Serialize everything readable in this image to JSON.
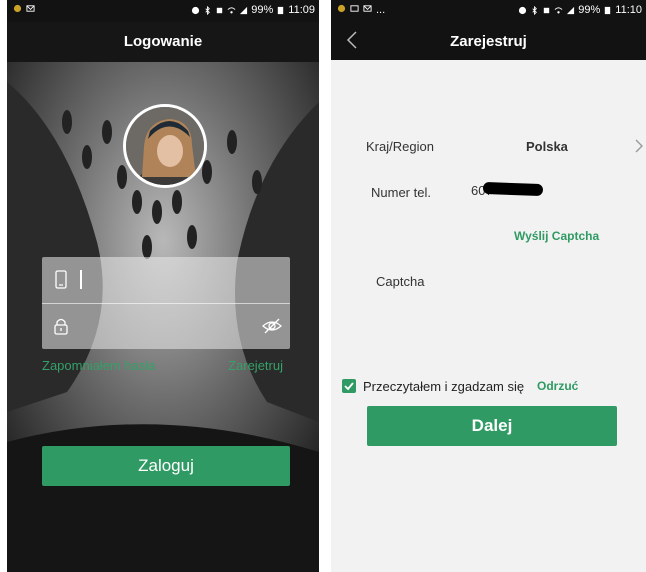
{
  "left_screen": {
    "status_bar": {
      "battery": "99%",
      "time": "11:09"
    },
    "title": "Logowanie",
    "phone_field": {
      "value": ""
    },
    "password_field": {
      "value": ""
    },
    "forgot_password": "Zapomniałem hasła",
    "register": "Zarejetruj",
    "login_button": "Zaloguj"
  },
  "right_screen": {
    "status_bar": {
      "extra": "...",
      "battery": "99%",
      "time": "11:10"
    },
    "title": "Zarejestruj",
    "region": {
      "label": "Kraj/Region",
      "value": "Polska"
    },
    "phone": {
      "label": "Numer tel.",
      "value": "607"
    },
    "send_captcha": "Wyślij Captcha",
    "captcha": {
      "label": "Captcha"
    },
    "terms": {
      "text": "Przeczytałem i zgadzam się",
      "checked": true
    },
    "reject": "Odrzuć",
    "next_button": "Dalej"
  },
  "colors": {
    "accent": "#2f9a63",
    "dark_bar": "#121212"
  }
}
